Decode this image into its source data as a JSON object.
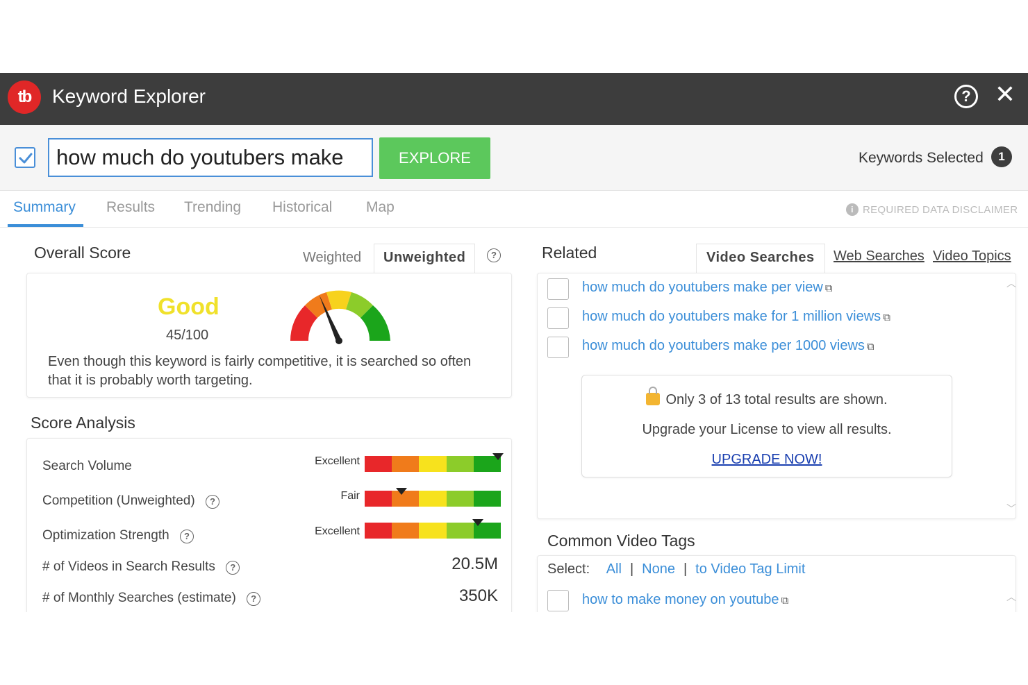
{
  "window": {
    "title": "Keyword Explorer",
    "logo_text": "tb"
  },
  "search": {
    "value": "how much do youtubers make",
    "placeholder": "",
    "explore_label": "EXPLORE"
  },
  "keywords_selected": {
    "label": "Keywords Selected",
    "count": "1"
  },
  "tabs": [
    {
      "label": "Summary",
      "active": true
    },
    {
      "label": "Results",
      "active": false
    },
    {
      "label": "Trending",
      "active": false
    },
    {
      "label": "Historical",
      "active": false
    },
    {
      "label": "Map",
      "active": false
    }
  ],
  "disclaimer": "REQUIRED DATA DISCLAIMER",
  "overall_score": {
    "heading": "Overall Score",
    "weighted_label": "Weighted",
    "unweighted_label": "Unweighted",
    "rating": "Good",
    "score": "45/100",
    "gauge_value": 45,
    "description": "Even though this keyword is fairly competitive, it is searched so often that it is probably worth targeting."
  },
  "score_analysis": {
    "heading": "Score Analysis",
    "metrics": [
      {
        "label": "Search Volume",
        "rating": "Excellent",
        "level": 0.98
      },
      {
        "label": "Competition (Unweighted)",
        "rating": "Fair",
        "level": 0.27
      },
      {
        "label": "Optimization Strength",
        "rating": "Excellent",
        "level": 0.83
      }
    ],
    "stats": [
      {
        "label": "# of Videos in Search Results",
        "value": "20.5M"
      },
      {
        "label": "# of Monthly Searches (estimate)",
        "value": "350K"
      }
    ]
  },
  "related": {
    "heading": "Related",
    "tabs": {
      "video_searches": "Video Searches",
      "web_searches": "Web Searches",
      "video_topics": "Video Topics"
    },
    "items": [
      "how much do youtubers make per view",
      "how much do youtubers make for 1 million views",
      "how much do youtubers make per 1000 views"
    ],
    "upsell": {
      "line1": "Only 3 of 13 total results are shown.",
      "line2": "Upgrade your License to view all results.",
      "cta": "UPGRADE NOW!"
    }
  },
  "tags": {
    "heading": "Common Video Tags",
    "select_label": "Select:",
    "options": [
      "All",
      "None",
      "to Video Tag Limit"
    ],
    "items": [
      "how to make money on youtube"
    ]
  },
  "colors": {
    "accent": "#3b8ed8",
    "explore": "#5cc85c",
    "titlebar": "#3d3d3d",
    "good": "#f0e12b"
  }
}
